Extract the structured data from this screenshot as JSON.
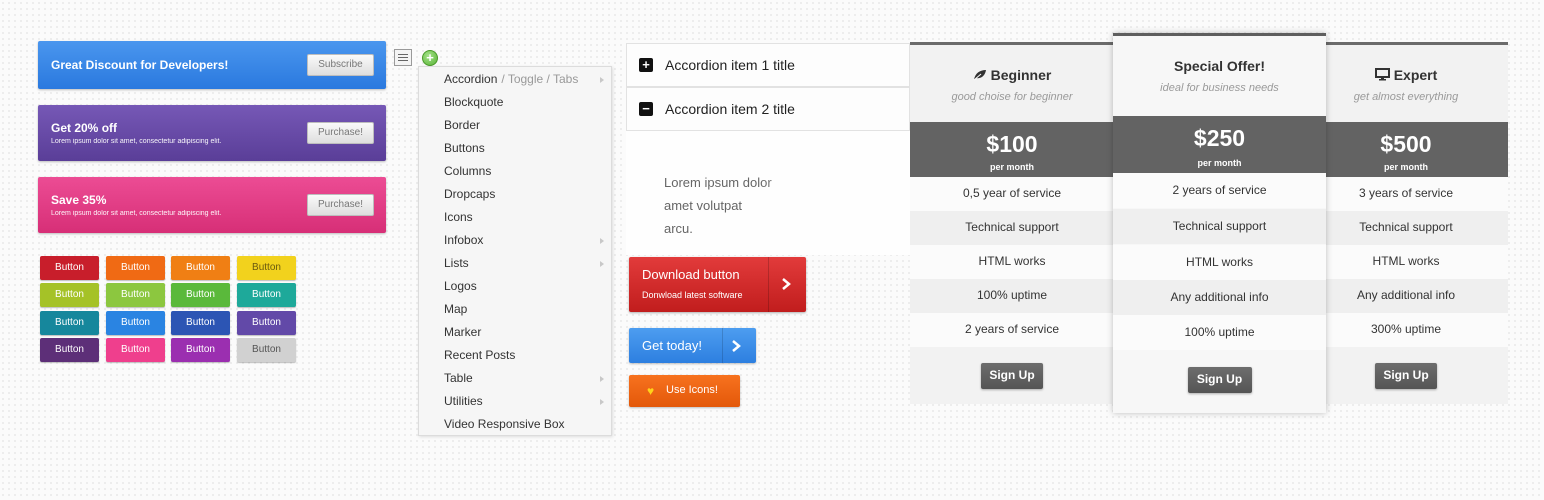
{
  "cta_boxes": [
    {
      "title": "Great Discount for Developers!",
      "subtitle": "",
      "button": "Subscribe"
    },
    {
      "title": "Get 20% off",
      "subtitle": "Lorem ipsum dolor sit amet, consectetur adipiscing elit.",
      "button": "Purchase!"
    },
    {
      "title": "Save 35%",
      "subtitle": "Lorem ipsum dolor sit amet, consectetur adipiscing elit.",
      "button": "Purchase!"
    }
  ],
  "color_buttons": {
    "label": "Button",
    "rows": [
      [
        "#c81e2b",
        "#f06a14",
        "#f07f14",
        "#f2d21d"
      ],
      [
        "#a5c227",
        "#8cc73f",
        "#5ab93b",
        "#1ea99a"
      ],
      [
        "#16879c",
        "#2a84e2",
        "#2c55b4",
        "#6249a8"
      ],
      [
        "#5d2f78",
        "#ef3f8d",
        "#9b2fb0",
        "#d1d1d1"
      ]
    ]
  },
  "menu": {
    "items": [
      {
        "label": "Accordion",
        "extra": "/ Toggle / Tabs",
        "submenu": true
      },
      {
        "label": "Blockquote",
        "submenu": false
      },
      {
        "label": "Border",
        "submenu": false
      },
      {
        "label": "Buttons",
        "submenu": false
      },
      {
        "label": "Columns",
        "submenu": false
      },
      {
        "label": "Dropcaps",
        "submenu": false
      },
      {
        "label": "Icons",
        "submenu": false
      },
      {
        "label": "Infobox",
        "submenu": true
      },
      {
        "label": "Lists",
        "submenu": true
      },
      {
        "label": "Logos",
        "submenu": false
      },
      {
        "label": "Map",
        "submenu": false
      },
      {
        "label": "Marker",
        "submenu": false
      },
      {
        "label": "Recent Posts",
        "submenu": false
      },
      {
        "label": "Table",
        "submenu": true
      },
      {
        "label": "Utilities",
        "submenu": true
      },
      {
        "label": "Video Responsive Box",
        "submenu": false
      }
    ]
  },
  "accordion": {
    "items": [
      {
        "title": "Accordion item 1 title",
        "icon": "+"
      },
      {
        "title": "Accordion item 2 title",
        "icon": "−"
      }
    ],
    "body": {
      "line1": "Lorem ipsum dolor",
      "line2": "amet volutpat",
      "line3": "arcu."
    }
  },
  "buttons": {
    "download": {
      "label": "Download button",
      "sub": "Donwload latest software"
    },
    "get_today": {
      "label": "Get today!"
    },
    "use_icons": {
      "label": "Use Icons!"
    }
  },
  "pricing": [
    {
      "name": "Beginner",
      "icon": "leaf-icon",
      "tagline": "good choise for beginner",
      "price": "$100",
      "period": "per month",
      "features": [
        "0,5 year of service",
        "Technical support",
        "HTML works",
        "100% uptime",
        "2 years of service"
      ],
      "cta": "Sign Up"
    },
    {
      "name": "Special Offer!",
      "icon": "",
      "tagline": "ideal for business needs",
      "price": "$250",
      "period": "per month",
      "features": [
        "2 years of service",
        "Technical support",
        "HTML works",
        "Any additional info",
        "100% uptime"
      ],
      "cta": "Sign Up"
    },
    {
      "name": "Expert",
      "icon": "monitor-icon",
      "tagline": "get almost everything",
      "price": "$500",
      "period": "per month",
      "features": [
        "3 years of service",
        "Technical support",
        "HTML works",
        "Any additional info",
        "300% uptime"
      ],
      "cta": "Sign Up"
    }
  ]
}
